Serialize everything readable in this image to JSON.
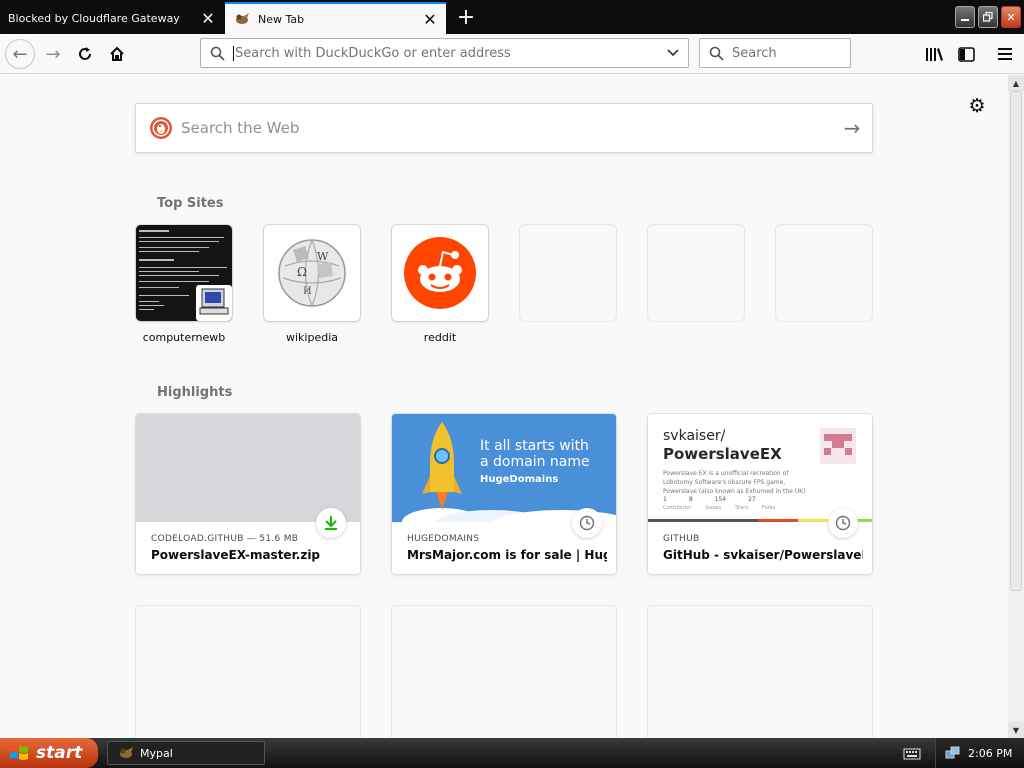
{
  "tabs": [
    {
      "title": "Blocked by Cloudflare Gateway",
      "active": false
    },
    {
      "title": "New Tab",
      "active": true
    }
  ],
  "toolbar": {
    "url_placeholder": "Search with DuckDuckGo or enter address",
    "search_placeholder": "Search"
  },
  "newtab": {
    "websearch_placeholder": "Search the Web",
    "top_sites_title": "Top Sites",
    "top_sites": [
      {
        "label": "computernewb",
        "icon": "computer-icon"
      },
      {
        "label": "wikipedia",
        "icon": "wikipedia-globe-icon"
      },
      {
        "label": "reddit",
        "icon": "reddit-icon"
      },
      {
        "label": ""
      },
      {
        "label": ""
      },
      {
        "label": ""
      }
    ],
    "highlights_title": "Highlights",
    "highlights": [
      {
        "meta": "CODELOAD.GITHUB — 51.6 MB",
        "title": "PowerslaveEX-master.zip",
        "badge": "download-icon"
      },
      {
        "meta": "HUGEDOMAINS",
        "title": "MrsMajor.com is for sale | Huge...",
        "badge": "clock-icon",
        "image_text": {
          "line1": "It all starts with",
          "line2": "a domain name",
          "brand": "HugeDomains"
        }
      },
      {
        "meta": "GITHUB",
        "title": "GitHub - svkaiser/PowerslaveEX...",
        "badge": "clock-icon",
        "image_text": {
          "user": "svkaiser/",
          "repo": "PowerslaveEX",
          "desc": "Powerslave EX is a unofficial recreation of Lobotomy Software's obscure FPS game, Powerslave (also known as Exhumed in the UK)",
          "stats": [
            "1",
            "8",
            "154",
            "27"
          ],
          "stat_labels": [
            "Contributor",
            "Issues",
            "Stars",
            "Forks"
          ]
        }
      }
    ]
  },
  "taskbar": {
    "start_label": "start",
    "task_label": "Mypal",
    "clock": "2:06 PM"
  },
  "colors": {
    "accent": "#0a84ff",
    "reddit": "#ff4500",
    "hugedomains_bg": "#4a90d9",
    "download_green": "#12bc00",
    "start_orange": "#d2502a"
  }
}
